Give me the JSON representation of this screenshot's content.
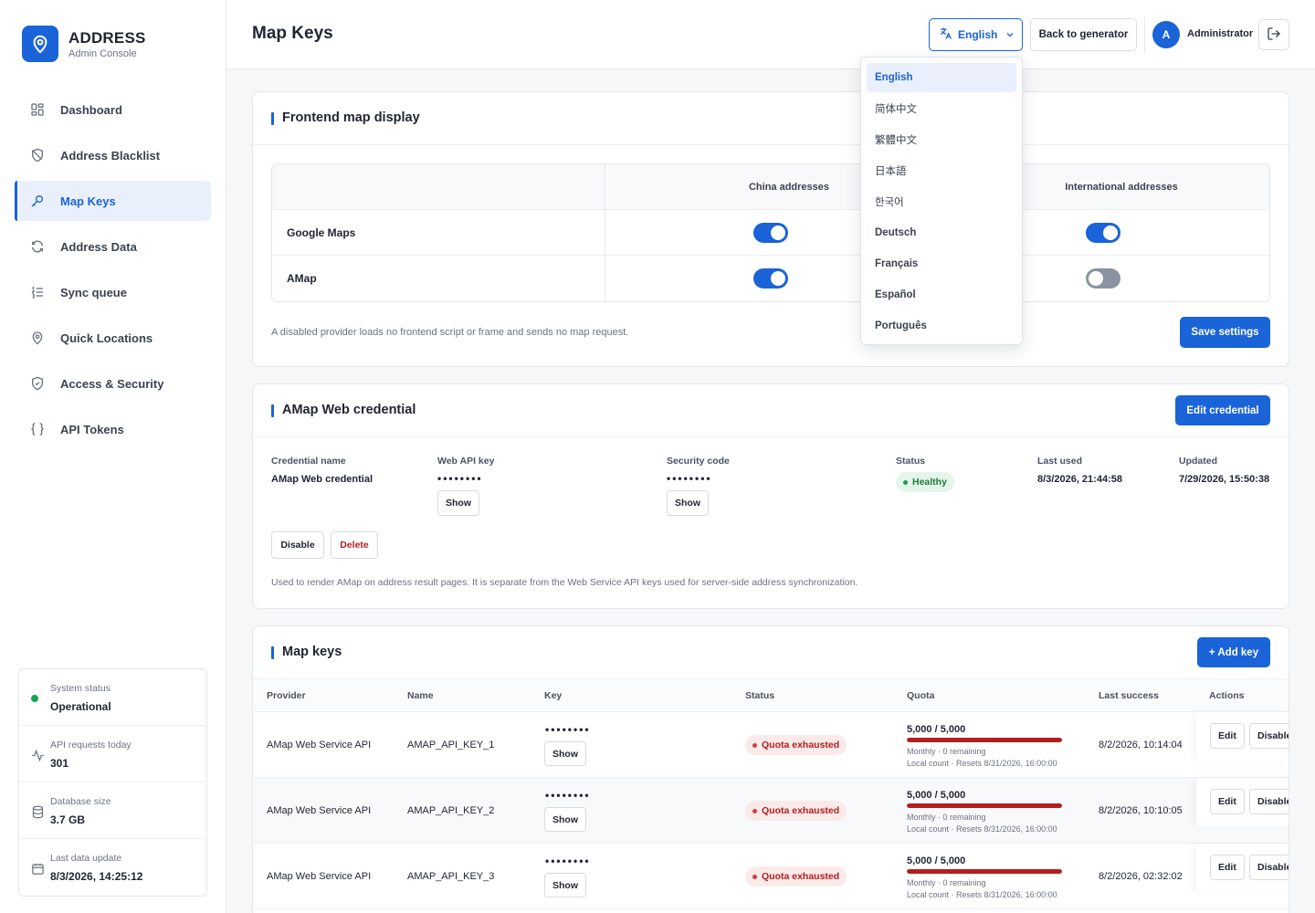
{
  "brand": {
    "title": "ADDRESS",
    "subtitle": "Admin Console"
  },
  "sidebar": {
    "items": [
      {
        "label": "Dashboard",
        "icon": "dashboard-icon"
      },
      {
        "label": "Address Blacklist",
        "icon": "shield-off-icon"
      },
      {
        "label": "Map Keys",
        "icon": "key-icon",
        "active": true
      },
      {
        "label": "Address Data",
        "icon": "refresh-icon"
      },
      {
        "label": "Sync queue",
        "icon": "list-ordered-icon"
      },
      {
        "label": "Quick Locations",
        "icon": "map-pin-icon"
      },
      {
        "label": "Access & Security",
        "icon": "shield-check-icon"
      },
      {
        "label": "API Tokens",
        "icon": "braces-icon"
      }
    ]
  },
  "system": {
    "status_label": "System status",
    "status_value": "Operational",
    "requests_label": "API requests today",
    "requests_value": "301",
    "db_label": "Database size",
    "db_value": "3.7 GB",
    "update_label": "Last data update",
    "update_value": "8/3/2026, 14:25:12"
  },
  "header": {
    "title": "Map Keys",
    "language": "English",
    "back_label": "Back to generator",
    "avatar_initial": "A",
    "user_name": "Administrator"
  },
  "language_menu": {
    "selected": "English",
    "options": [
      "English",
      "简体中文",
      "繁體中文",
      "日本語",
      "한국어",
      "Deutsch",
      "Français",
      "Español",
      "Português"
    ]
  },
  "display": {
    "title": "Frontend map display",
    "col_china": "China addresses",
    "col_intl": "International addresses",
    "rows": [
      {
        "provider": "Google Maps",
        "china": true,
        "intl": true
      },
      {
        "provider": "AMap",
        "china": true,
        "intl": false
      }
    ],
    "note": "A disabled provider loads no frontend script or frame and sends no map request.",
    "save_label": "Save settings"
  },
  "credential": {
    "title": "AMap Web credential",
    "edit_label": "Edit credential",
    "name_label": "Credential name",
    "name_value": "AMap Web credential",
    "apikey_label": "Web API key",
    "apikey_mask": "••••••••",
    "security_label": "Security code",
    "security_mask": "••••••••",
    "show_label": "Show",
    "status_label": "Status",
    "status_value": "Healthy",
    "last_used_label": "Last used",
    "last_used_value": "8/3/2026, 21:44:58",
    "updated_label": "Updated",
    "updated_value": "7/29/2026, 15:50:38",
    "disable_label": "Disable",
    "delete_label": "Delete",
    "note": "Used to render AMap on address result pages. It is separate from the Web Service API keys used for server-side address synchronization."
  },
  "keys": {
    "title": "Map keys",
    "add_label": "+ Add key",
    "headers": {
      "provider": "Provider",
      "name": "Name",
      "key": "Key",
      "status": "Status",
      "quota": "Quota",
      "last_success": "Last success",
      "actions": "Actions"
    },
    "show_label": "Show",
    "edit_label": "Edit",
    "disable_label": "Disable",
    "rows": [
      {
        "provider": "AMap Web Service API",
        "name": "AMAP_API_KEY_1",
        "mask": "••••••••",
        "status": "Quota exhausted",
        "quota": "5,000 / 5,000",
        "quota_fraction": 1.0,
        "quota_sub1": "Monthly · 0 remaining",
        "quota_sub2": "Local count · Resets 8/31/2026, 16:00:00",
        "last_success": "8/2/2026, 10:14:04"
      },
      {
        "provider": "AMap Web Service API",
        "name": "AMAP_API_KEY_2",
        "mask": "••••••••",
        "status": "Quota exhausted",
        "quota": "5,000 / 5,000",
        "quota_fraction": 1.0,
        "quota_sub1": "Monthly · 0 remaining",
        "quota_sub2": "Local count · Resets 8/31/2026, 16:00:00",
        "last_success": "8/2/2026, 10:10:05"
      },
      {
        "provider": "AMap Web Service API",
        "name": "AMAP_API_KEY_3",
        "mask": "••••••••",
        "status": "Quota exhausted",
        "quota": "5,000 / 5,000",
        "quota_fraction": 1.0,
        "quota_sub1": "Monthly · 0 remaining",
        "quota_sub2": "Local count · Resets 8/31/2026, 16:00:00",
        "last_success": "8/2/2026, 02:32:02"
      }
    ]
  },
  "colors": {
    "accent": "#1a63d8",
    "danger": "#b41e1e",
    "success": "#18a35a"
  }
}
